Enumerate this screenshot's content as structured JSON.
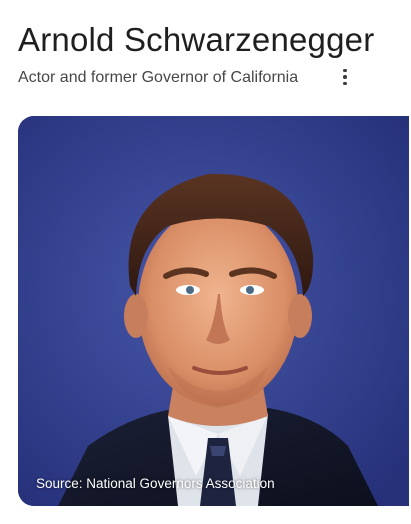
{
  "header": {
    "title": "Arnold Schwarzenegger",
    "subtitle": "Actor and former Governor of California",
    "more_icon": "more-vert-icon"
  },
  "image": {
    "source_caption": "Source: National Governors Association",
    "background_color": "#2f3d8a"
  }
}
